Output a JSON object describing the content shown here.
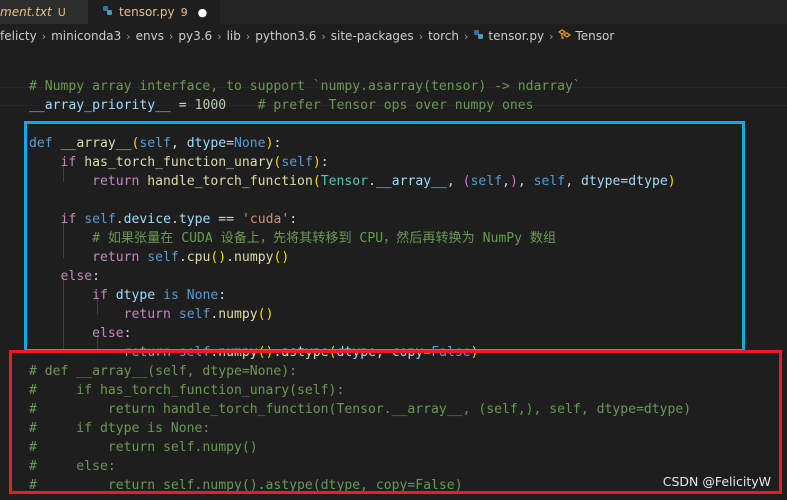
{
  "tabs": [
    {
      "label": "ment.txt",
      "status": "U"
    },
    {
      "label": "tensor.py",
      "problems": "9",
      "modified": "●"
    }
  ],
  "breadcrumb": {
    "items": [
      "felicty",
      "miniconda3",
      "envs",
      "py3.6",
      "lib",
      "python3.6",
      "site-packages",
      "torch",
      "tensor.py",
      "Tensor"
    ],
    "separator": "›"
  },
  "code_lines": [
    "# Numpy array interface, to support `numpy.asarray(tensor) -> ndarray`",
    "__array_priority__ = 1000    # prefer Tensor ops over numpy ones",
    "def __array__(self, dtype=None):",
    "    if has_torch_function_unary(self):",
    "        return handle_torch_function(Tensor.__array__, (self,), self, dtype=dtype)",
    "    if self.device.type == 'cuda':",
    "        # 如果张量在 CUDA 设备上，先将其转移到 CPU，然后再转换为 NumPy 数组",
    "        return self.cpu().numpy()",
    "    else:",
    "        if dtype is None:",
    "            return self.numpy()",
    "        else:",
    "            return self.numpy().astype(dtype, copy=False)",
    "# def __array__(self, dtype=None):",
    "#     if has_torch_function_unary(self):",
    "#         return handle_torch_function(Tensor.__array__, (self,), self, dtype=dtype)",
    "#     if dtype is None:",
    "#         return self.numpy()",
    "#     else:",
    "#         return self.numpy().astype(dtype, copy=False)"
  ],
  "watermark": "CSDN @FelicityW",
  "colors": {
    "highlight_box_blue": "#13a8e8",
    "highlight_box_red": "#ee1c1c",
    "editor_background": "#1e1e1e",
    "modified_tab_text": "#e2c08d"
  },
  "icons": [
    "python-file-icon",
    "class-symbol-icon",
    "chevron-right-icon",
    "unsaved-dot-icon"
  ]
}
